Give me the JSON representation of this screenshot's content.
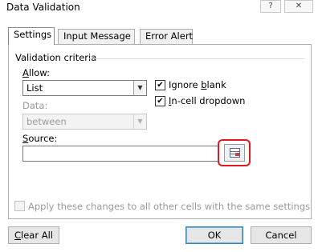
{
  "window": {
    "title": "Data Validation",
    "help_label": "?",
    "close_label": "✕"
  },
  "tabs": [
    {
      "label": "Settings",
      "active": true
    },
    {
      "label": "Input Message",
      "active": false
    },
    {
      "label": "Error Alert",
      "active": false
    }
  ],
  "criteria": {
    "group_title": "Validation criteria",
    "allow_label_pre": "",
    "allow_label_ul": "A",
    "allow_label_post": "llow:",
    "allow_value": "List",
    "data_label": "Data:",
    "data_value": "between",
    "ignore_blank_pre": "Ignore ",
    "ignore_blank_ul": "b",
    "ignore_blank_post": "lank",
    "ignore_blank_checked": true,
    "incell_pre": "",
    "incell_ul": "I",
    "incell_post": "n-cell dropdown",
    "incell_checked": true,
    "source_label_pre": "",
    "source_label_ul": "S",
    "source_label_post": "ource:",
    "source_value": ""
  },
  "apply": {
    "label": "Apply these changes to all other cells with the same settings",
    "checked": false
  },
  "buttons": {
    "clear_pre": "",
    "clear_ul": "C",
    "clear_post": "lear All",
    "ok": "OK",
    "cancel": "Cancel"
  },
  "colors": {
    "highlight": "#e0181f",
    "ok_border": "#3c7fb1"
  }
}
